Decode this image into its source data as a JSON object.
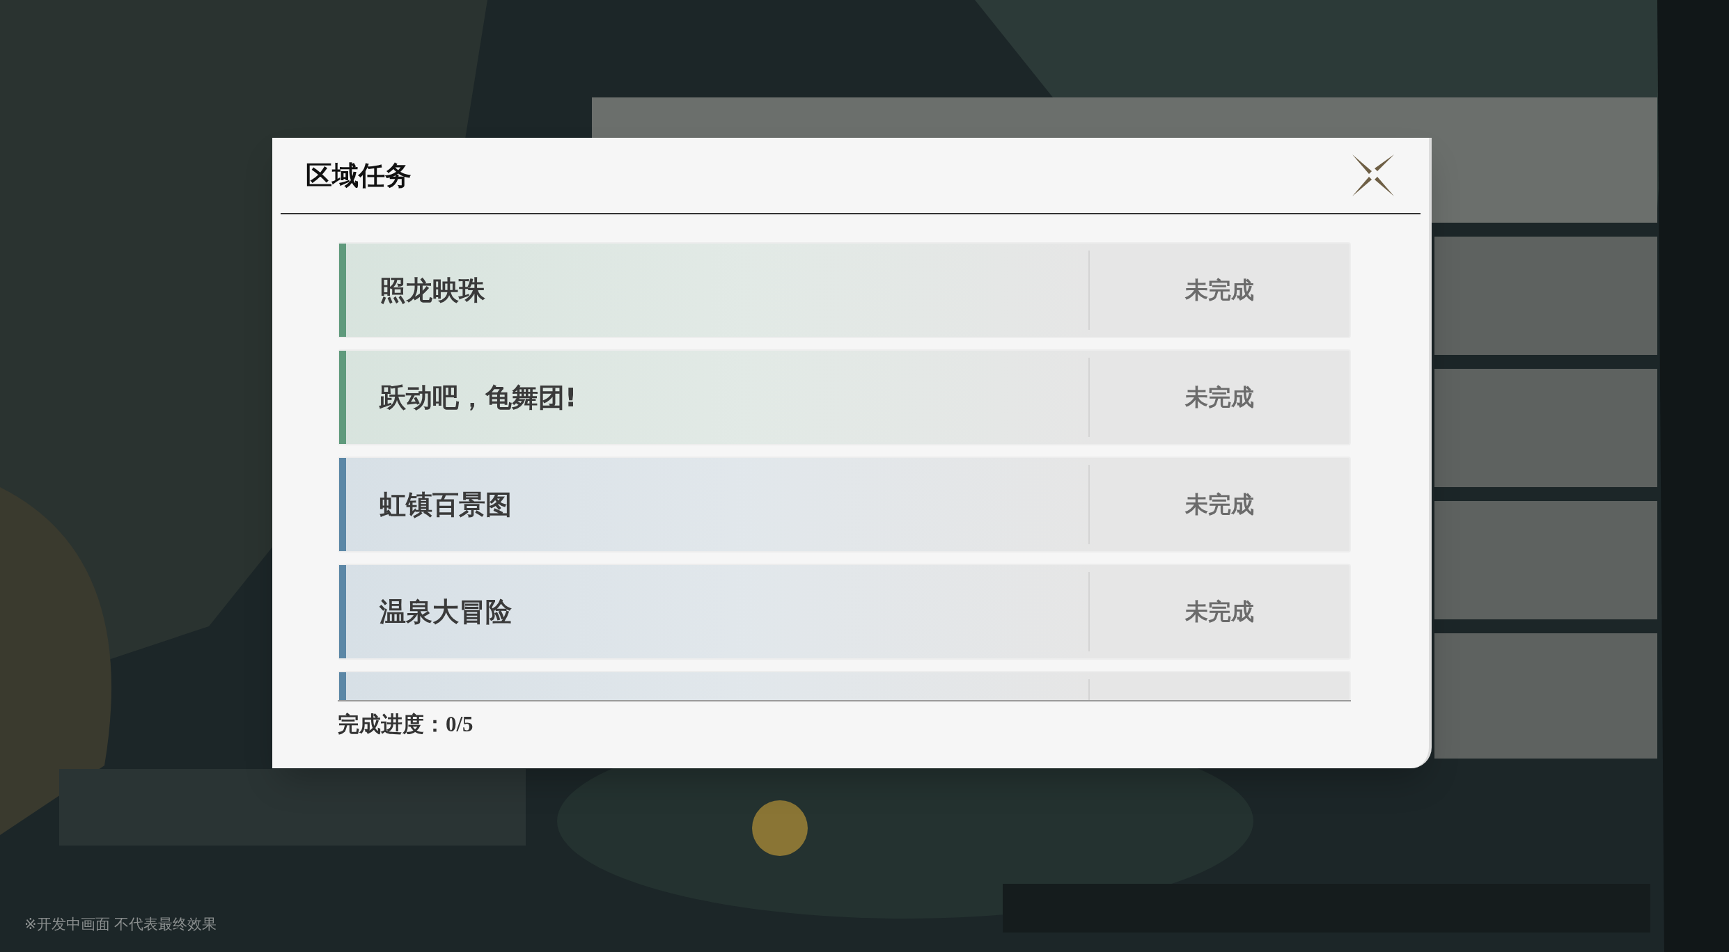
{
  "dialog": {
    "title": "区域任务",
    "quests": [
      {
        "title": "照龙映珠",
        "status": "未完成",
        "color": "#5f9a7c"
      },
      {
        "title": "跃动吧，龟舞团!",
        "status": "未完成",
        "color": "#5f9a7c"
      },
      {
        "title": "虹镇百景图",
        "status": "未完成",
        "color": "#5b87a6"
      },
      {
        "title": "温泉大冒险",
        "status": "未完成",
        "color": "#5b87a6"
      },
      {
        "color": "#5b87a6"
      }
    ],
    "progress": "完成进度：0/5"
  },
  "footnote": "※开发中画面 不代表最终效果"
}
